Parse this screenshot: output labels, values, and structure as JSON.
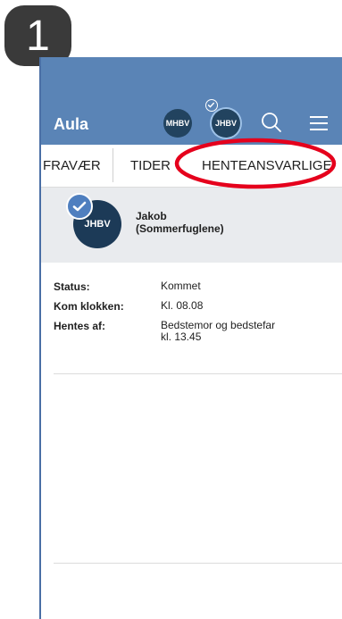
{
  "step_number": "1",
  "header": {
    "title": "Aula",
    "avatars": [
      {
        "initials": "MHBV"
      },
      {
        "initials": "JHBV"
      }
    ]
  },
  "tabs": [
    "FRAVÆR",
    "TIDER",
    "HENTEANSVARLIGE"
  ],
  "child": {
    "initials": "JHBV",
    "name_line1": "Jakob",
    "name_line2": "(Sommerfuglene)"
  },
  "details": [
    {
      "label": "Status:",
      "value": "Kommet"
    },
    {
      "label": "Kom klokken:",
      "value": "Kl. 08.08"
    },
    {
      "label": "Hentes af:",
      "value": "Bedstemor og bedstefar",
      "value2": "kl. 13.45"
    }
  ],
  "colors": {
    "header_bg": "#5a84b6",
    "highlight": "#e5001c",
    "avatar_bg": "#1c3a57"
  }
}
